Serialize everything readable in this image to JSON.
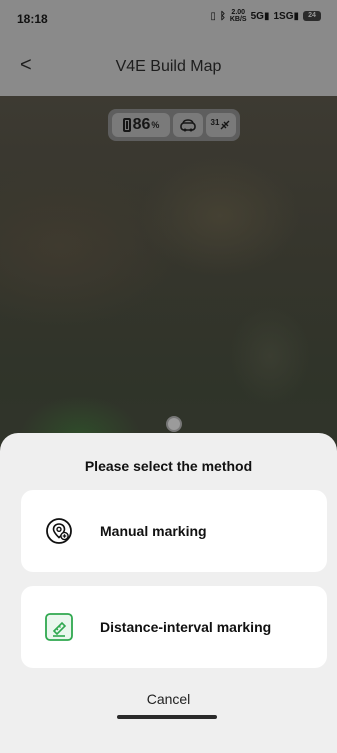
{
  "status_bar": {
    "time": "18:18",
    "net_speed": "2.00",
    "net_unit": "KB/S",
    "signal1": "5G",
    "signal2": "1SG",
    "battery": "24"
  },
  "app_bar": {
    "back_label": "<",
    "title": "V4E Build Map"
  },
  "telemetry": {
    "battery_value": "86",
    "battery_unit": "%",
    "satellites": "31"
  },
  "sheet": {
    "heading": "Please select the method",
    "options": [
      {
        "label": "Manual marking",
        "icon": "location-pin-plus-icon"
      },
      {
        "label": "Distance-interval marking",
        "icon": "ruler-edit-icon"
      }
    ],
    "cancel_label": "Cancel"
  },
  "colors": {
    "accent_green": "#2fa84f",
    "sheet_bg": "#efefef",
    "overlay": "#8a8a8a"
  }
}
